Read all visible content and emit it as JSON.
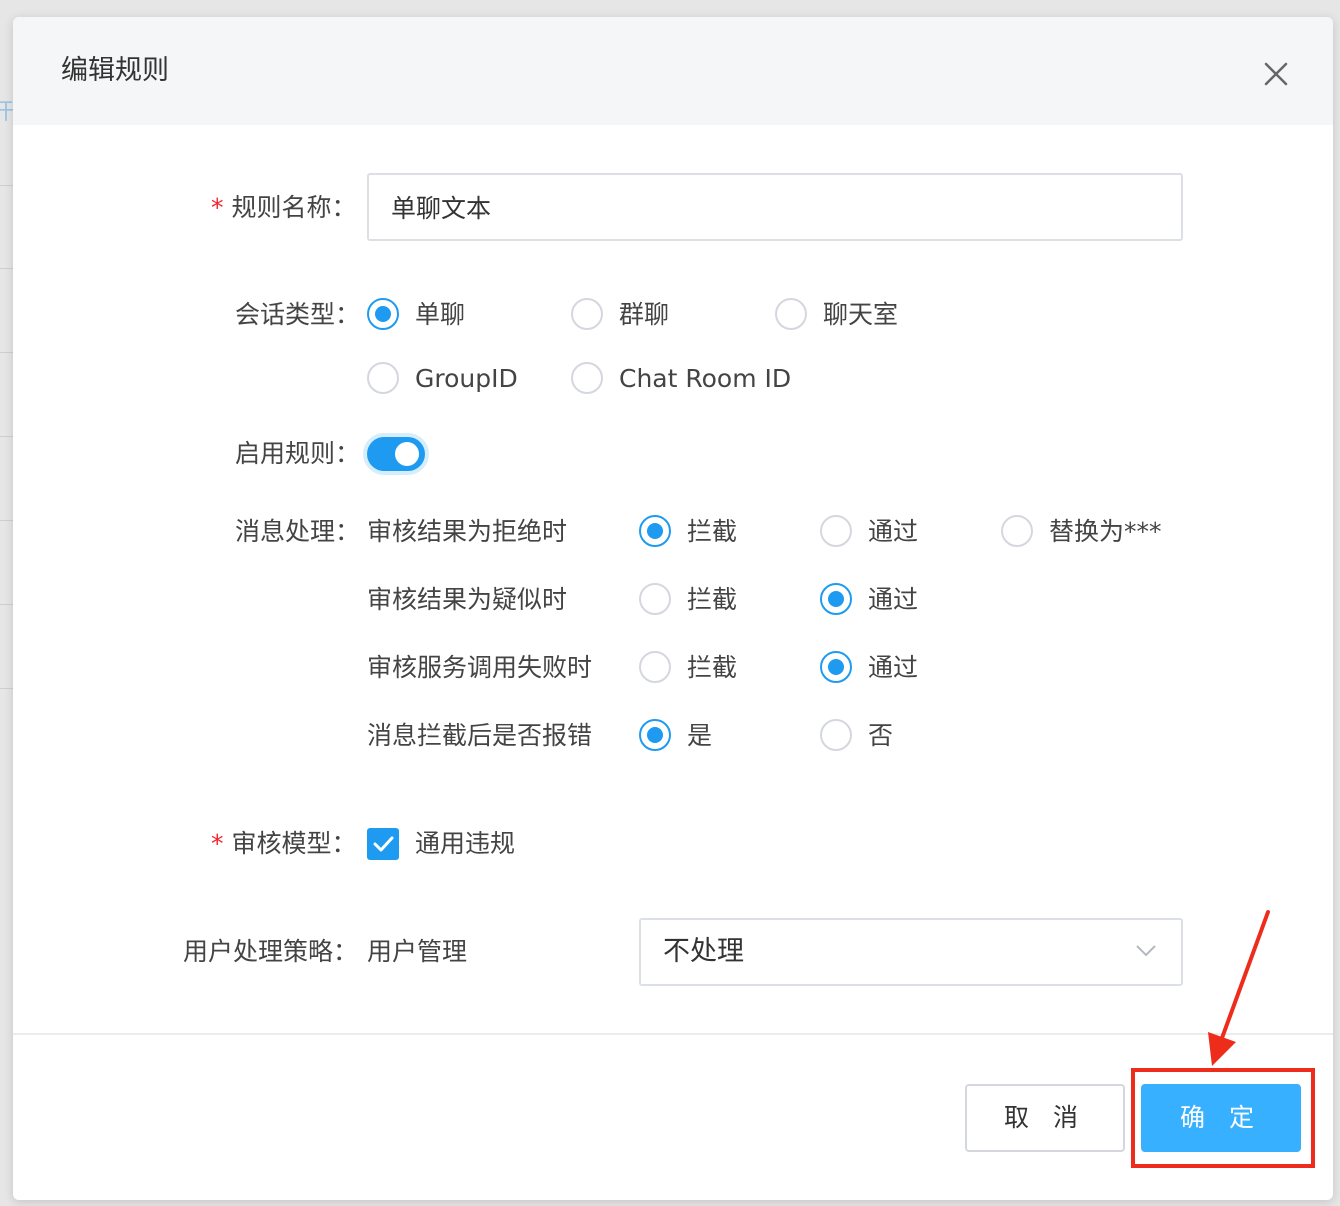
{
  "dialog": {
    "title": "编辑规则"
  },
  "form": {
    "rule_name": {
      "label": "规则名称：",
      "required": true,
      "value": "单聊文本"
    },
    "conversation_type": {
      "label": "会话类型：",
      "options": [
        {
          "label": "单聊",
          "checked": true
        },
        {
          "label": "群聊",
          "checked": false
        },
        {
          "label": "聊天室",
          "checked": false
        },
        {
          "label": "GroupID",
          "checked": false
        },
        {
          "label": "Chat Room ID",
          "checked": false
        }
      ]
    },
    "enable_rule": {
      "label": "启用规则：",
      "on": true
    },
    "message_handling": {
      "label": "消息处理：",
      "rows": [
        {
          "label": "审核结果为拒绝时",
          "options": [
            {
              "label": "拦截",
              "checked": true
            },
            {
              "label": "通过",
              "checked": false
            },
            {
              "label": "替换为***",
              "checked": false
            }
          ]
        },
        {
          "label": "审核结果为疑似时",
          "options": [
            {
              "label": "拦截",
              "checked": false
            },
            {
              "label": "通过",
              "checked": true
            }
          ]
        },
        {
          "label": "审核服务调用失败时",
          "options": [
            {
              "label": "拦截",
              "checked": false
            },
            {
              "label": "通过",
              "checked": true
            }
          ]
        },
        {
          "label": "消息拦截后是否报错",
          "options": [
            {
              "label": "是",
              "checked": true
            },
            {
              "label": "否",
              "checked": false
            }
          ]
        }
      ]
    },
    "review_model": {
      "label": "审核模型：",
      "required": true,
      "option": {
        "label": "通用违规",
        "checked": true
      }
    },
    "user_strategy": {
      "label": "用户处理策略：",
      "sub_label": "用户管理",
      "selected": "不处理"
    }
  },
  "footer": {
    "cancel_label": "取 消",
    "confirm_label": "确 定"
  },
  "colors": {
    "accent": "#1e9bf0",
    "confirm_button": "#37b0ff",
    "annotation_red": "#ee2c1c",
    "required_star": "#f5222d"
  },
  "icons": {
    "close": "close-icon",
    "dropdown": "chevron-down-icon",
    "checkbox": "check-icon"
  }
}
